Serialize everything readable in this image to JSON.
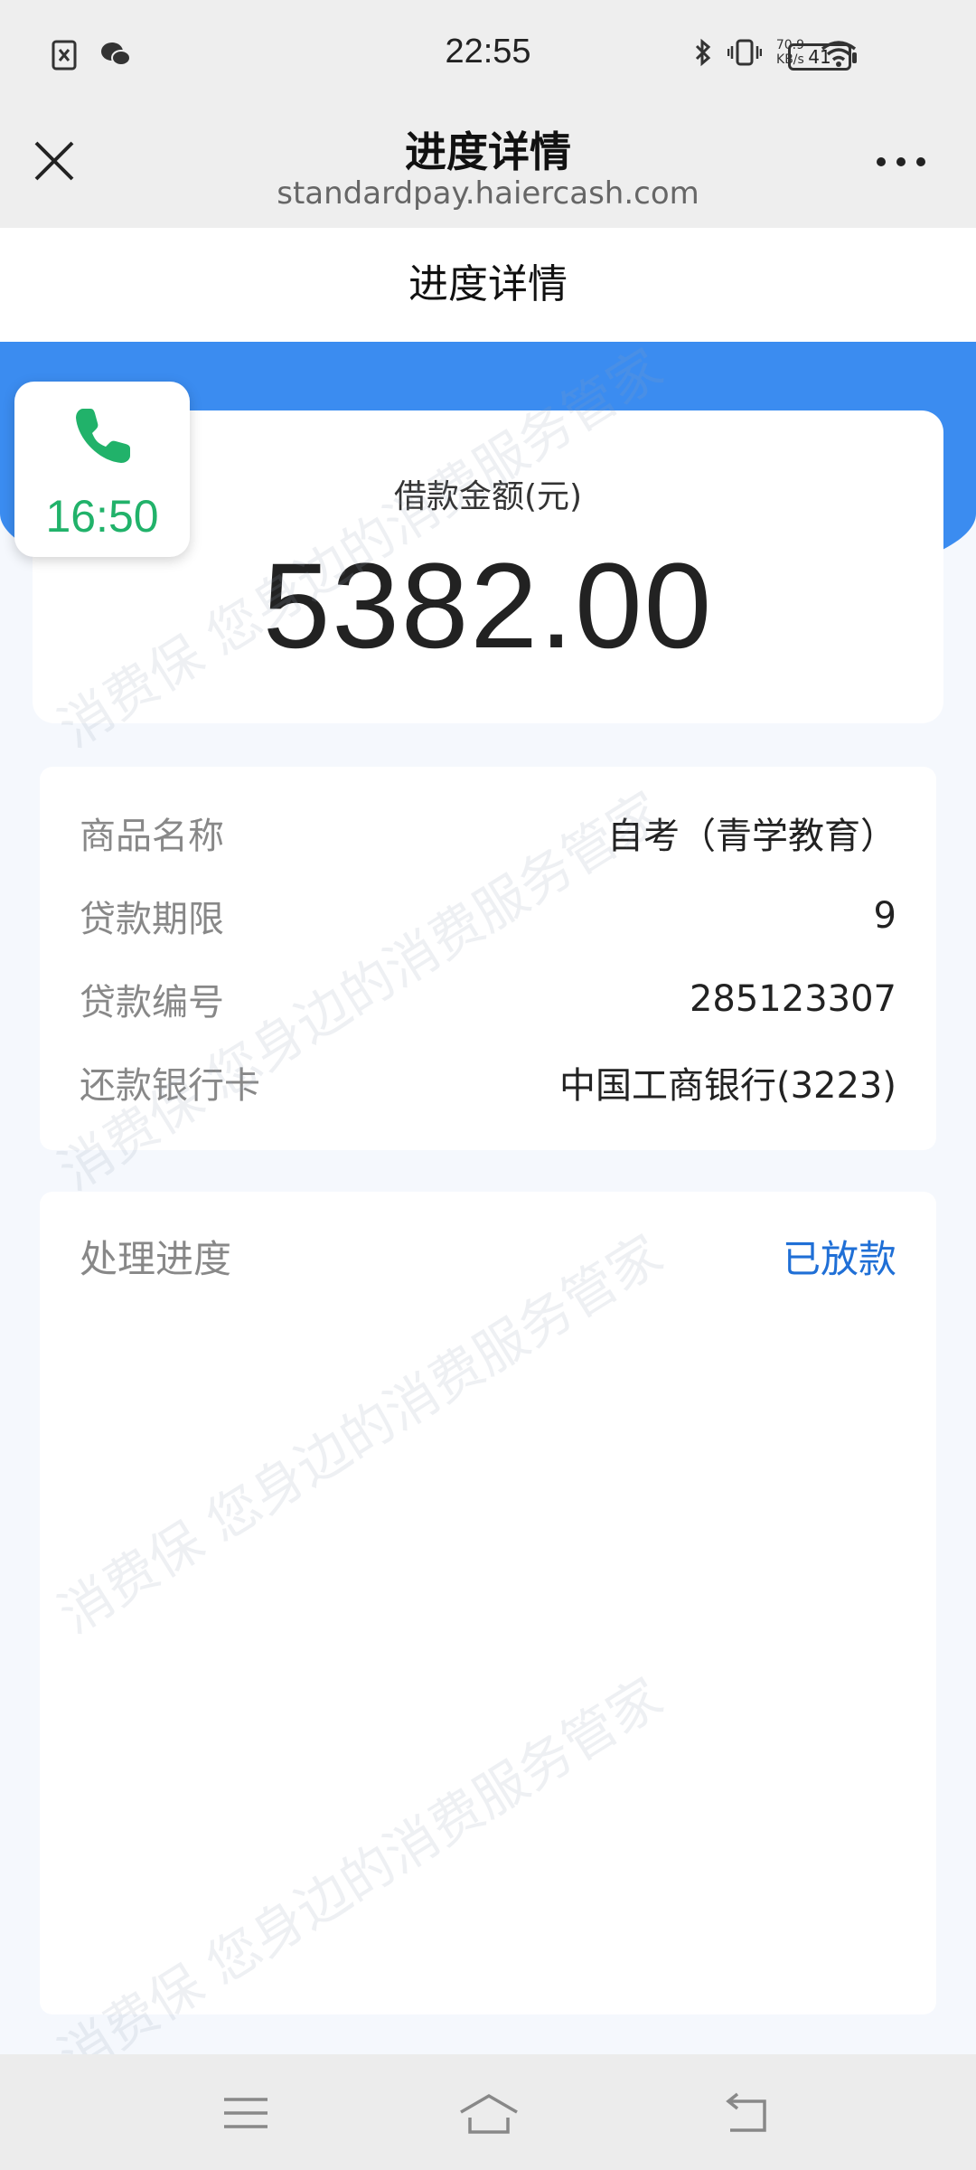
{
  "status_bar": {
    "time": "22:55",
    "net_speed_value": "70.9",
    "net_speed_unit": "KB/s",
    "battery": "41"
  },
  "nav": {
    "title": "进度详情",
    "url": "standardpay.haiercash.com"
  },
  "page": {
    "header_title": "进度详情"
  },
  "call": {
    "timer": "16:50"
  },
  "amount": {
    "label": "借款金额(元)",
    "value": "5382.00"
  },
  "info": {
    "rows": [
      {
        "key": "商品名称",
        "value": "自考（青学教育）"
      },
      {
        "key": "贷款期限",
        "value": "9"
      },
      {
        "key": "贷款编号",
        "value": "285123307"
      },
      {
        "key": "还款银行卡",
        "value": "中国工商银行(3223)"
      }
    ]
  },
  "progress": {
    "key": "处理进度",
    "status": "已放款"
  },
  "watermark_text": "消费保 您身边的消费服务管家",
  "colors": {
    "accent_blue": "#3b8cf0",
    "status_blue": "#1f6fd6",
    "call_green": "#21b26a"
  }
}
